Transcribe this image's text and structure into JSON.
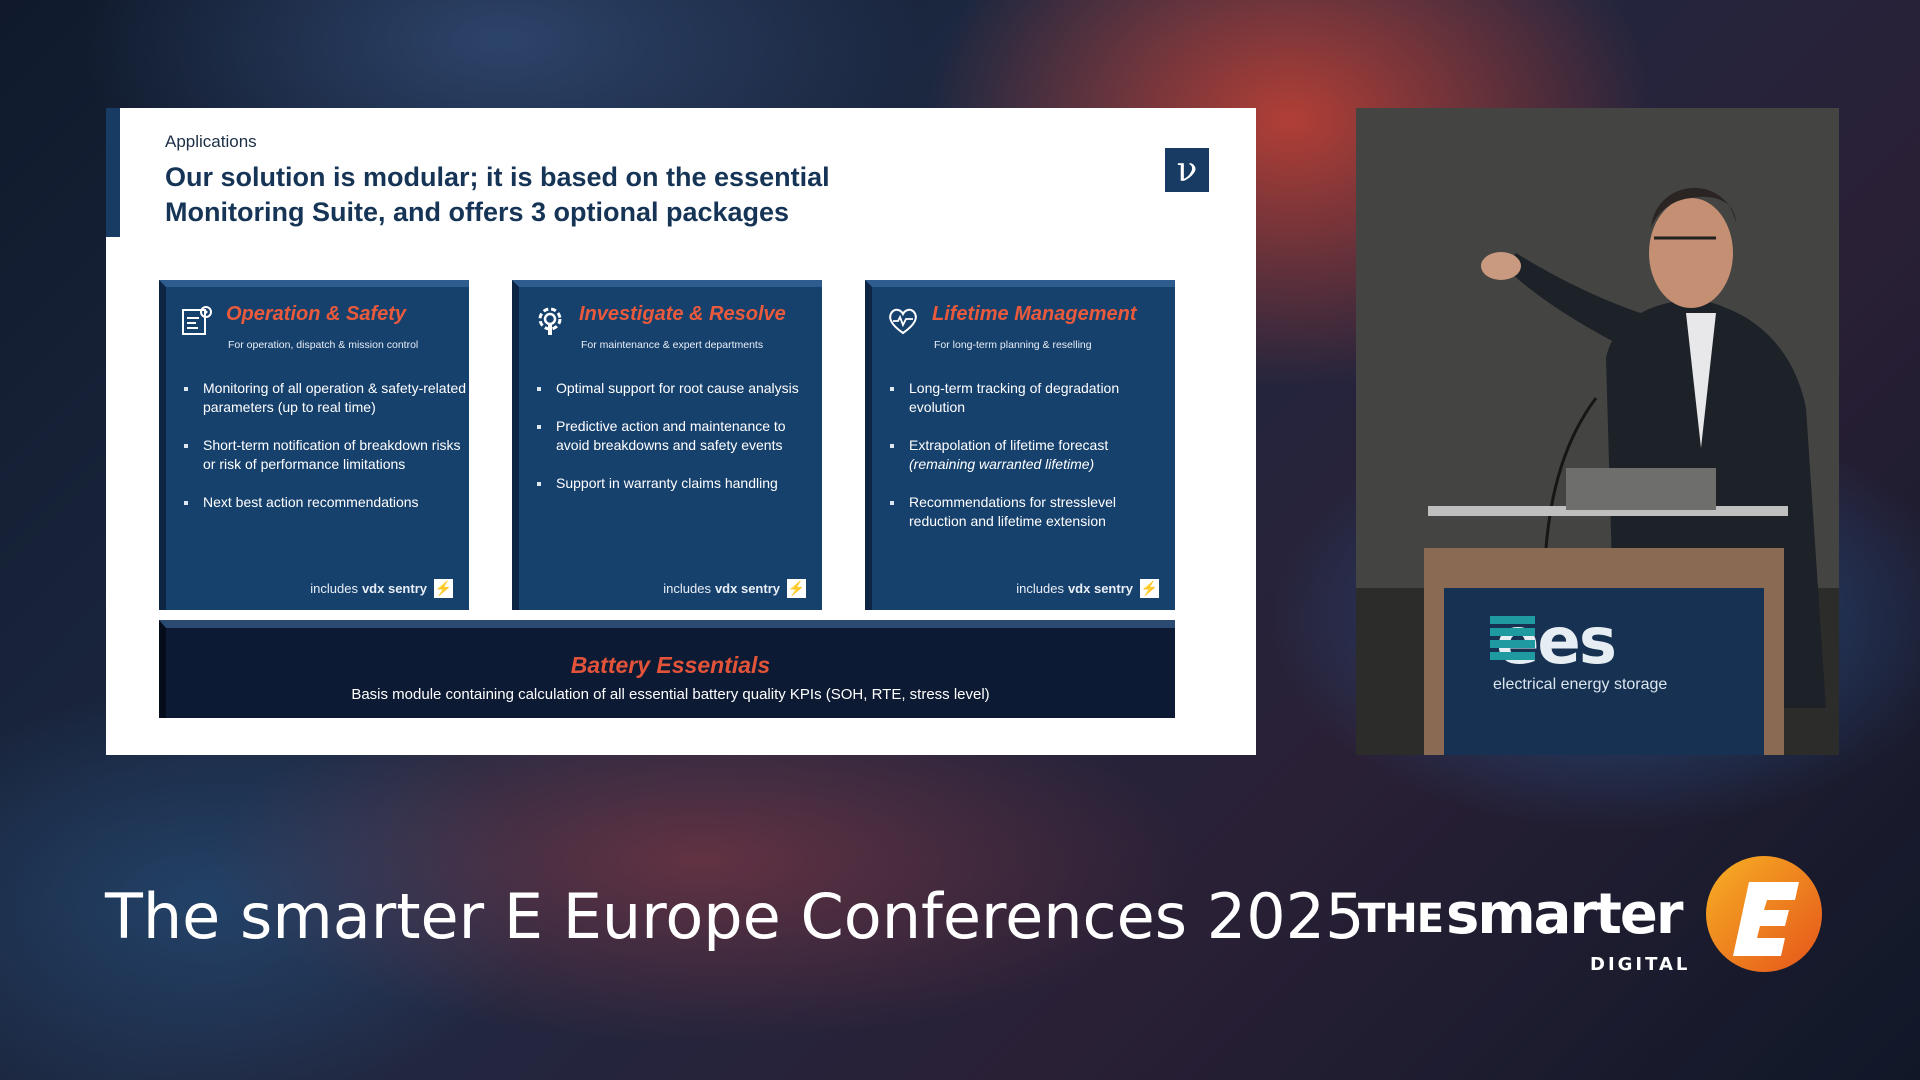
{
  "slide": {
    "section_label": "Applications",
    "title": "Our solution is modular; it is based on the essential Monitoring Suite, and offers 3 optional packages",
    "logo_letter": "V"
  },
  "cards": [
    {
      "icon": "gear-checklist-icon",
      "title": "Operation & Safety",
      "subtitle": "For operation, dispatch & mission control",
      "bullets": [
        "Monitoring of all operation & safety-related parameters (up to real time)",
        "Short-term notification of breakdown risks or risk of performance limitations",
        "Next best action recommendations"
      ],
      "sentry_prefix": "includes",
      "sentry_name": "vdx sentry"
    },
    {
      "icon": "wrench-gear-icon",
      "title": "Investigate & Resolve",
      "subtitle": "For maintenance & expert departments",
      "bullets": [
        "Optimal support for root cause analysis",
        "Predictive action and maintenance to avoid breakdowns and safety events",
        "Support in warranty claims handling"
      ],
      "sentry_prefix": "includes",
      "sentry_name": "vdx sentry"
    },
    {
      "icon": "heart-pulse-icon",
      "title": "Lifetime Management",
      "subtitle": "For long-term planning & reselling",
      "bullets": [
        "Long-term tracking of degradation evolution",
        "Extrapolation of lifetime forecast",
        "Recommendations for stresslevel reduction and lifetime extension"
      ],
      "bullet_note": "(remaining warranted lifetime)",
      "sentry_prefix": "includes",
      "sentry_name": "vdx sentry"
    }
  ],
  "essentials": {
    "title": "Battery Essentials",
    "subtitle": "Basis module containing calculation of all essential battery quality KPIs (SOH, RTE, stress level)"
  },
  "podium": {
    "brand": "ees",
    "tagline": "electrical energy storage"
  },
  "footer": {
    "conference_title": "The smarter E Europe Conferences 2025",
    "brand_the": "THE",
    "brand_smarter": "smarter",
    "brand_digital": "DIGITAL"
  },
  "colors": {
    "navy": "#17416d",
    "accent_orange": "#e95a3c",
    "slide_bg": "#ffffff"
  }
}
